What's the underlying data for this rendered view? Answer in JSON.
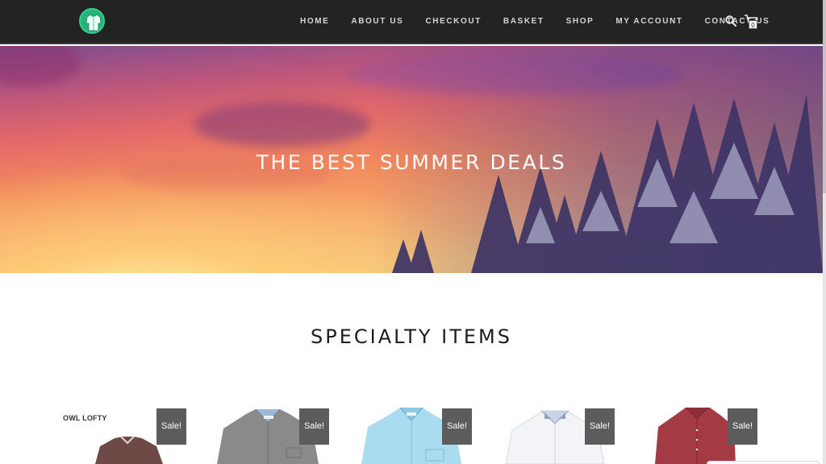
{
  "nav": {
    "items": [
      "HOME",
      "ABOUT US",
      "CHECKOUT",
      "BASKET",
      "SHOP",
      "MY ACCOUNT",
      "CONTACT US"
    ],
    "basket_count": "0"
  },
  "hero": {
    "title": "THE BEST SUMMER DEALS"
  },
  "section": {
    "title": "SPECIALTY ITEMS"
  },
  "products": [
    {
      "badge": "Sale!",
      "brand": "OWL LOFTY",
      "shirt_color": "#6e4a46"
    },
    {
      "badge": "Sale!",
      "shirt_color": "#8a8a8a"
    },
    {
      "badge": "Sale!",
      "shirt_color": "#a9dcef"
    },
    {
      "badge": "Sale!",
      "shirt_color": "#f2f4f8"
    },
    {
      "badge": "Sale!",
      "shirt_color": "#a33a44"
    }
  ],
  "colors": {
    "header_bg": "#232323",
    "logo_green": "#25b37a",
    "badge_bg": "#5c5c5c"
  },
  "icons": [
    "logo-shirt-icon",
    "search-icon",
    "basket-icon"
  ]
}
